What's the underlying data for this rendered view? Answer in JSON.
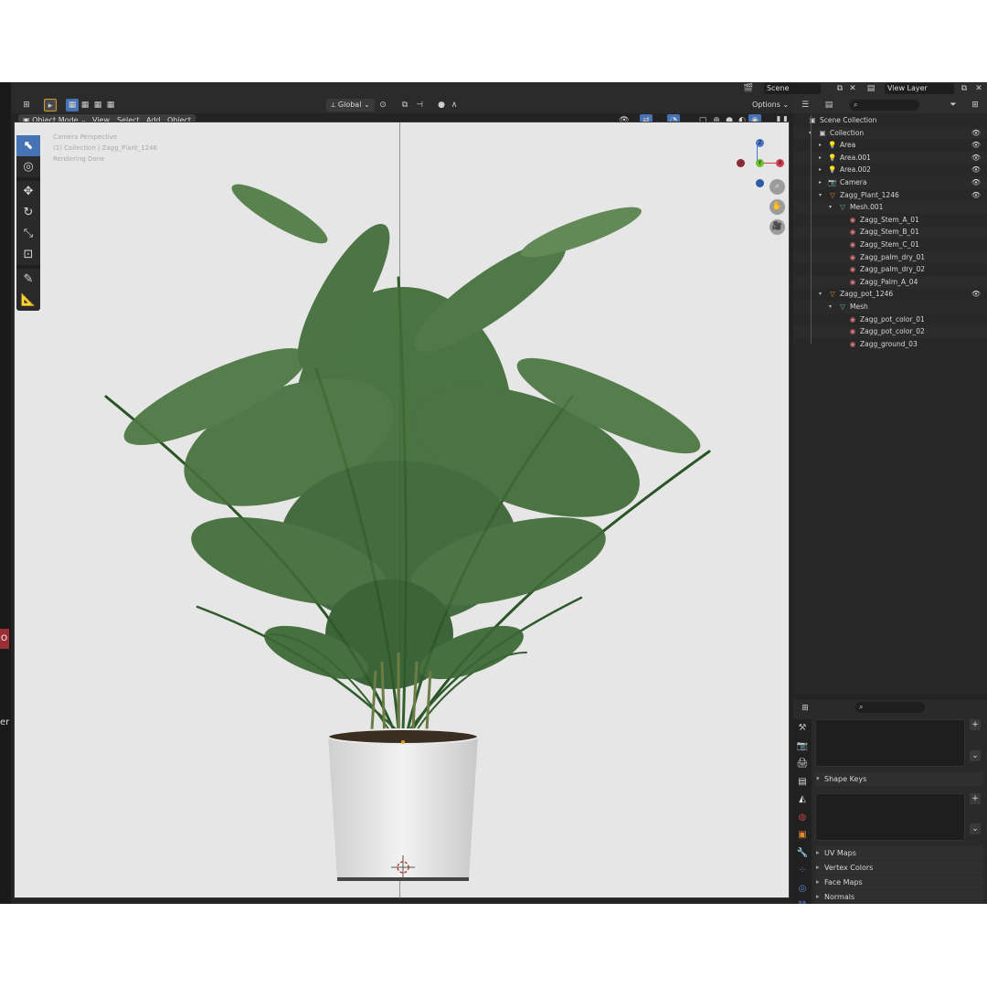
{
  "topbar": {
    "scene_label": "Scene",
    "view_layer_label": "View Layer",
    "options_label": "Options",
    "transform_orientation": "Global"
  },
  "header": {
    "mode": "Object Mode",
    "menus": [
      "View",
      "Select",
      "Add",
      "Object"
    ]
  },
  "viewport": {
    "info_lines": [
      "Camera Perspective",
      "(1) Collection | Zagg_Plant_1246",
      "Rendering Done"
    ],
    "axes": {
      "z": "Z",
      "y": "Y",
      "x": "X"
    },
    "colors": {
      "background": "#e6e6e6",
      "active_tool": "#4772b3"
    }
  },
  "tools": [
    "select-box-icon",
    "cursor-icon",
    "move-icon",
    "rotate-icon",
    "scale-icon",
    "transform-icon",
    "annotate-icon",
    "measure-icon"
  ],
  "outliner": {
    "search_placeholder": "",
    "rows": [
      {
        "label": "Scene Collection",
        "icon": "▣",
        "indent": 0,
        "eye": false
      },
      {
        "label": "Collection",
        "icon": "▣",
        "indent": 1,
        "eye": true
      },
      {
        "label": "Area",
        "icon": "💡",
        "indent": 2,
        "eye": true
      },
      {
        "label": "Area.001",
        "icon": "💡",
        "indent": 2,
        "eye": true
      },
      {
        "label": "Area.002",
        "icon": "💡",
        "indent": 2,
        "eye": true
      },
      {
        "label": "Camera",
        "icon": "📷",
        "indent": 2,
        "eye": true
      },
      {
        "label": "Zagg_Plant_1246",
        "icon": "▽",
        "indent": 2,
        "eye": true
      },
      {
        "label": "Mesh.001",
        "icon": "▽",
        "indent": 3,
        "eye": false
      },
      {
        "label": "Zagg_Stem_A_01",
        "icon": "◉",
        "indent": 4,
        "eye": false,
        "mat": true
      },
      {
        "label": "Zagg_Stem_B_01",
        "icon": "◉",
        "indent": 4,
        "eye": false,
        "mat": true
      },
      {
        "label": "Zagg_Stem_C_01",
        "icon": "◉",
        "indent": 4,
        "eye": false,
        "mat": true
      },
      {
        "label": "Zagg_palm_dry_01",
        "icon": "◉",
        "indent": 4,
        "eye": false,
        "mat": true
      },
      {
        "label": "Zagg_palm_dry_02",
        "icon": "◉",
        "indent": 4,
        "eye": false,
        "mat": true
      },
      {
        "label": "Zagg_Palm_A_04",
        "icon": "◉",
        "indent": 4,
        "eye": false,
        "mat": true
      },
      {
        "label": "Zagg_pot_1246",
        "icon": "▽",
        "indent": 2,
        "eye": true
      },
      {
        "label": "Mesh",
        "icon": "▽",
        "indent": 3,
        "eye": false
      },
      {
        "label": "Zagg_pot_color_01",
        "icon": "◉",
        "indent": 4,
        "eye": false,
        "mat": true
      },
      {
        "label": "Zagg_pot_color_02",
        "icon": "◉",
        "indent": 4,
        "eye": false,
        "mat": true
      },
      {
        "label": "Zagg_ground_03",
        "icon": "◉",
        "indent": 4,
        "eye": false,
        "mat": true
      }
    ]
  },
  "properties": {
    "sections": [
      "Shape Keys",
      "UV Maps",
      "Vertex Colors",
      "Face Maps",
      "Normals"
    ]
  }
}
